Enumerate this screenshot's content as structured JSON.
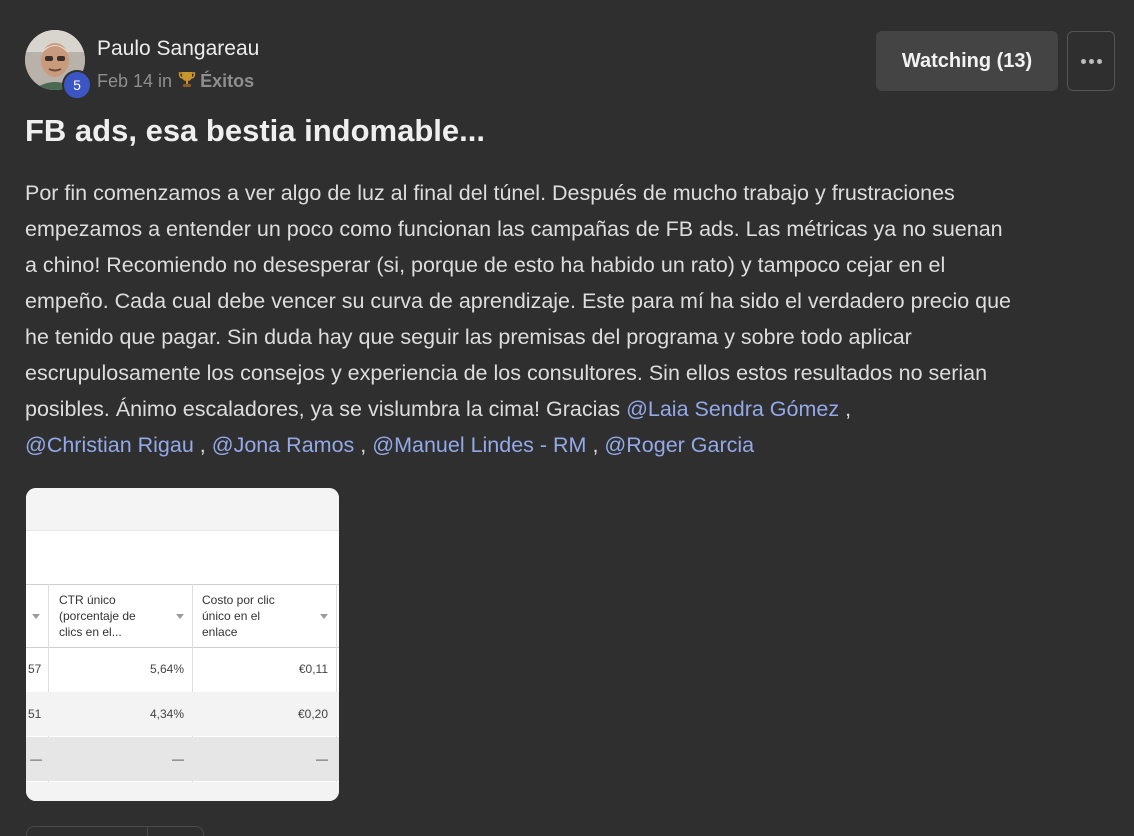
{
  "post": {
    "author": {
      "name": "Paulo Sangareau",
      "level": "5",
      "date": "Feb 14",
      "in_word": "in",
      "category_icon": "trophy-icon",
      "category": "Éxitos"
    },
    "watch_label": "Watching (13)",
    "more_icon": "more-horizontal-icon",
    "title": "FB ads, esa bestia indomable...",
    "body_lines": [
      "Por fin comenzamos a ver algo de luz al final del túnel. Después de mucho trabajo y frustraciones",
      "empezamos a entender un poco como funcionan las campañas de FB ads. Las métricas ya no suenan",
      "a chino! Recomiendo no desesperar (si, porque de esto ha habido un rato) y tampoco cejar en el",
      "empeño. Cada cual debe vencer su curva de aprendizaje. Este para mí ha sido el verdadero precio que",
      "he tenido que pagar. Sin duda hay que seguir las premisas del programa y sobre todo aplicar",
      "escrupulosamente los consejos y experiencia de los consultores. Sin ellos estos resultados no serian"
    ],
    "body_line7_text": "posibles. Ánimo escaladores, ya se vislumbra la cima! Gracias",
    "mentions": [
      "@Laia Sendra Gómez",
      "@Christian Rigau",
      "@Jona Ramos",
      "@Manuel Lindes - RM",
      "@Roger Garcia"
    ],
    "mention_separator": ",",
    "attachment": {
      "columns": [
        "CTR único (porcentaje de clics en el...",
        "Costo por clic único en el enlace"
      ],
      "rows": [
        {
          "prev": "57",
          "ctr": "5,64%",
          "cost": "€0,11"
        },
        {
          "prev": "51",
          "ctr": "4,34%",
          "cost": "€0,20"
        },
        {
          "prev": "—",
          "ctr": "—",
          "cost": "—"
        },
        {
          "prev": "—",
          "ctr": "—",
          "cost": "—"
        }
      ]
    }
  }
}
